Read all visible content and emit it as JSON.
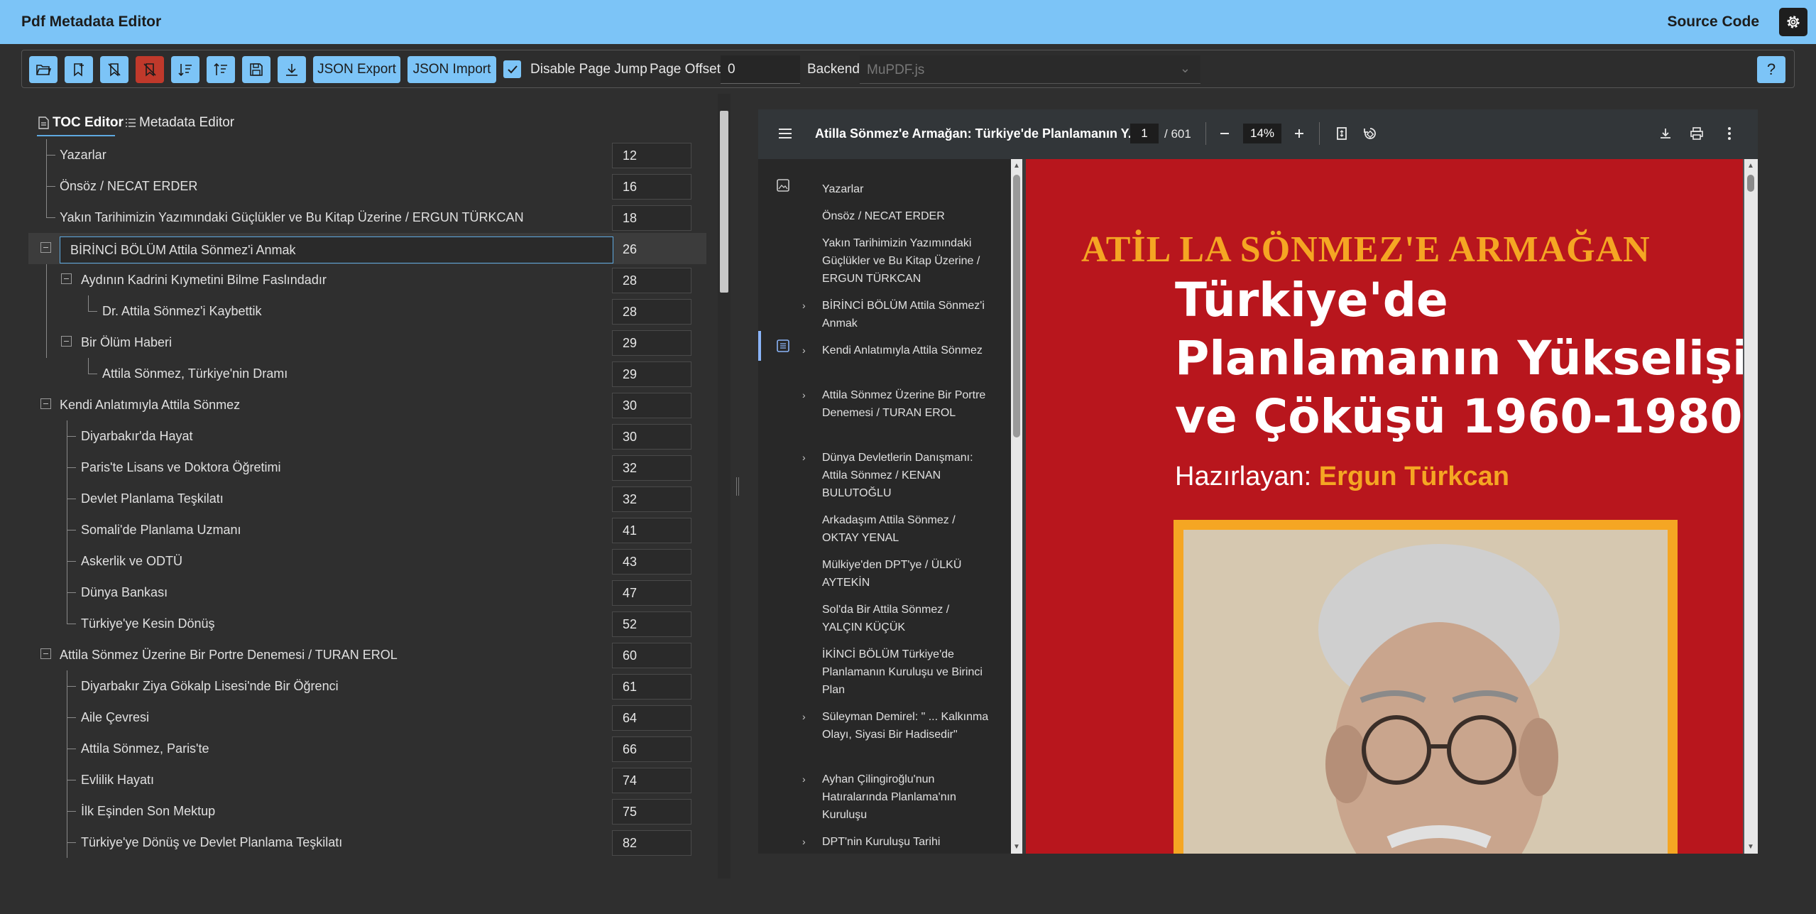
{
  "app": {
    "title": "Pdf Metadata Editor",
    "source_code": "Source Code"
  },
  "toolbar": {
    "json_export": "JSON Export",
    "json_import": "JSON Import",
    "disable_page_jump": "Disable Page Jump",
    "page_offset_label": "Page Offset",
    "page_offset_value": "0",
    "backend_label": "Backend",
    "backend_value": "MuPDF.js",
    "help": "?",
    "accent_color": "#7cc4f7"
  },
  "tabs": {
    "toc_editor": "TOC Editor",
    "metadata_editor": "Metadata Editor"
  },
  "toc": [
    {
      "title": "Yazarlar",
      "page": "12"
    },
    {
      "title": "Önsöz / NECAT ERDER",
      "page": "16"
    },
    {
      "title": "Yakın Tarihimizin Yazımındaki Güçlükler ve Bu Kitap Üzerine / ERGUN TÜRKCAN",
      "page": "18"
    },
    {
      "title": "BİRİNCİ BÖLÜM Attila Sönmez'i Anmak",
      "page": "26"
    },
    {
      "title": "Aydının Kadrini Kıymetini Bilme Faslındadır",
      "page": "28"
    },
    {
      "title": "Dr. Attila Sönmez'i Kaybettik",
      "page": "28"
    },
    {
      "title": "Bir Ölüm Haberi",
      "page": "29"
    },
    {
      "title": "Attila Sönmez, Türkiye'nin Dramı",
      "page": "29"
    },
    {
      "title": "Kendi Anlatımıyla Attila Sönmez",
      "page": "30"
    },
    {
      "title": "Diyarbakır'da Hayat",
      "page": "30"
    },
    {
      "title": "Paris'te Lisans ve Doktora Öğretimi",
      "page": "32"
    },
    {
      "title": "Devlet Planlama Teşkilatı",
      "page": "32"
    },
    {
      "title": "Somali'de Planlama Uzmanı",
      "page": "41"
    },
    {
      "title": "Askerlik ve ODTÜ",
      "page": "43"
    },
    {
      "title": "Dünya Bankası",
      "page": "47"
    },
    {
      "title": "Türkiye'ye Kesin Dönüş",
      "page": "52"
    },
    {
      "title": "Attila Sönmez Üzerine Bir Portre Denemesi / TURAN EROL",
      "page": "60"
    },
    {
      "title": "Diyarbakır Ziya Gökalp Lisesi'nde Bir Öğrenci",
      "page": "61"
    },
    {
      "title": "Aile Çevresi",
      "page": "64"
    },
    {
      "title": "Attila Sönmez, Paris'te",
      "page": "66"
    },
    {
      "title": "Evlilik Hayatı",
      "page": "74"
    },
    {
      "title": "İlk Eşinden Son Mektup",
      "page": "75"
    },
    {
      "title": "Türkiye'ye Dönüş ve Devlet Planlama Teşkilatı",
      "page": "82"
    }
  ],
  "viewer": {
    "doc_title": "Atilla Sönmez'e Armağan: Türkiye'de Planlamanın Y...",
    "page_current": "1",
    "page_total": "/ 601",
    "zoom": "14%",
    "outline": [
      {
        "label": "Yazarlar",
        "expandable": false
      },
      {
        "label": "Önsöz / NECAT ERDER",
        "expandable": false
      },
      {
        "label": "Yakın Tarihimizin Yazımındaki Güçlükler ve Bu Kitap Üzerine / ERGUN TÜRKCAN",
        "expandable": false
      },
      {
        "label": "BİRİNCİ BÖLÜM Attila Sönmez'i Anmak",
        "expandable": true
      },
      {
        "label": "Kendi Anlatımıyla Attila Sönmez",
        "expandable": true
      },
      {
        "label": "Attila Sönmez Üzerine Bir Portre Denemesi / TURAN EROL",
        "expandable": true
      },
      {
        "label": "Dünya Devletlerin Danışmanı: Attila Sönmez / KENAN BULUTOĞLU",
        "expandable": true
      },
      {
        "label": "Arkadaşım Attila Sönmez / OKTAY YENAL",
        "expandable": false
      },
      {
        "label": "Mülkiye'den DPT'ye / ÜLKÜ AYTEKİN",
        "expandable": false
      },
      {
        "label": "Sol'da Bir Attila Sönmez / YALÇIN KÜÇÜK",
        "expandable": false
      },
      {
        "label": "İKİNCİ BÖLÜM Türkiye'de Planlamanın Kuruluşu ve Birinci Plan",
        "expandable": false
      },
      {
        "label": "Süleyman Demirel: \" ... Kalkınma Olayı, Siyasi Bir Hadisedir\"",
        "expandable": true
      },
      {
        "label": "Ayhan Çilingiroğlu'nun Hatıralarında Planlama'nın Kuruluşu",
        "expandable": true
      },
      {
        "label": "DPT'nin Kuruluşu Tarihi",
        "expandable": true
      }
    ]
  },
  "cover": {
    "editor_line": "ATİL LA SÖNMEZ'E ARMAĞAN",
    "title": "Türkiye'de\nPlanlamanın Yükselişi\nve Çöküşü 1960-1980",
    "prepared_by_label": "Hazırlayan:",
    "prepared_by_name": "Ergun Türkcan",
    "background_color": "#b8161d",
    "accent_color": "#f5a623"
  }
}
